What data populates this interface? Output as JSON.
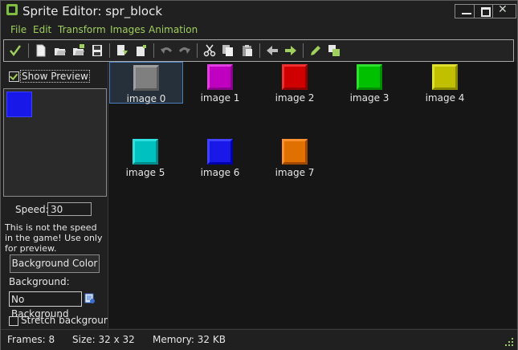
{
  "window": {
    "title": "Sprite Editor: spr_block",
    "min_label": "",
    "max_label": "",
    "close_label": "✕"
  },
  "menu": {
    "items": [
      {
        "label": "File"
      },
      {
        "label": "Edit"
      },
      {
        "label": "Transform"
      },
      {
        "label": "Images"
      },
      {
        "label": "Animation"
      }
    ]
  },
  "toolbar": {
    "icons": [
      "ok-check-icon",
      "new-icon",
      "open-icon",
      "open-strip-icon",
      "save-icon",
      "import-icon",
      "insert-icon",
      "undo-icon",
      "redo-icon",
      "cut-icon",
      "copy-icon",
      "paste-icon",
      "move-left-icon",
      "move-right-icon",
      "edit-pencil-icon",
      "merge-icon"
    ]
  },
  "preview": {
    "show_label": "Show Preview",
    "checked": true,
    "sprite_color": "#1818e8"
  },
  "settings": {
    "speed_label": "Speed:",
    "speed_value": "30",
    "note": "This is not the speed in the game! Use only for preview.",
    "bgcolor_button": "Background Color",
    "background_label": "Background:",
    "background_value": "No Background",
    "stretch_label": "Stretch background",
    "stretch_checked": false
  },
  "images": [
    {
      "label": "image 0",
      "color": "#7f7f7f",
      "light": "#a0a0a0",
      "dark": "#5a5a5a",
      "selected": true
    },
    {
      "label": "image 1",
      "color": "#c000c0",
      "light": "#e040e0",
      "dark": "#8a008a",
      "selected": false
    },
    {
      "label": "image 2",
      "color": "#d00000",
      "light": "#f03030",
      "dark": "#900000",
      "selected": false
    },
    {
      "label": "image 3",
      "color": "#00c000",
      "light": "#30e030",
      "dark": "#008a00",
      "selected": false
    },
    {
      "label": "image 4",
      "color": "#c0c000",
      "light": "#e0e030",
      "dark": "#8a8a00",
      "selected": false
    },
    {
      "label": "image 5",
      "color": "#00c0c0",
      "light": "#30e0e0",
      "dark": "#008a8a",
      "selected": false
    },
    {
      "label": "image 6",
      "color": "#1818e8",
      "light": "#4040ff",
      "dark": "#0000a8",
      "selected": false
    },
    {
      "label": "image 7",
      "color": "#e07000",
      "light": "#ff9030",
      "dark": "#a04800",
      "selected": false
    }
  ],
  "status": {
    "frames": "Frames: 8",
    "size": "Size: 32 x 32",
    "memory": "Memory: 32 KB"
  }
}
